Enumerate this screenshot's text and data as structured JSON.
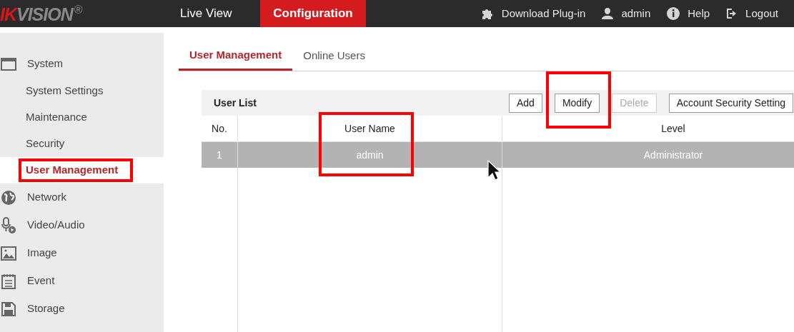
{
  "logo": {
    "accent": "IK",
    "text": "VISION",
    "mark": "®"
  },
  "nav": [
    {
      "label": "Live View",
      "selected": false
    },
    {
      "label": "Configuration",
      "selected": true
    }
  ],
  "header_actions": [
    {
      "kind": "plugin",
      "label": "Download Plug-in"
    },
    {
      "kind": "user",
      "label": "admin"
    },
    {
      "kind": "help",
      "label": "Help"
    },
    {
      "kind": "logout",
      "label": "Logout"
    }
  ],
  "sidebar": {
    "items": [
      {
        "kind": "system",
        "label": "System",
        "children": [
          {
            "label": "System Settings",
            "selected": false
          },
          {
            "label": "Maintenance",
            "selected": false
          },
          {
            "label": "Security",
            "selected": false
          },
          {
            "label": "User Management",
            "selected": true,
            "highlighted": true
          }
        ]
      },
      {
        "kind": "network",
        "label": "Network"
      },
      {
        "kind": "video",
        "label": "Video/Audio"
      },
      {
        "kind": "image",
        "label": "Image"
      },
      {
        "kind": "event",
        "label": "Event"
      },
      {
        "kind": "storage",
        "label": "Storage"
      }
    ]
  },
  "tabs": [
    {
      "label": "User Management",
      "selected": true
    },
    {
      "label": "Online Users",
      "selected": false
    }
  ],
  "user_list": {
    "title": "User List",
    "buttons": [
      {
        "label": "Add",
        "disabled": false
      },
      {
        "label": "Modify",
        "disabled": false,
        "highlighted": true
      },
      {
        "label": "Delete",
        "disabled": true
      },
      {
        "label": "Account Security Setting",
        "disabled": false
      }
    ],
    "columns": [
      {
        "label": "No."
      },
      {
        "label": "User Name",
        "highlighted": true
      },
      {
        "label": "Level"
      }
    ],
    "rows": [
      {
        "cells": [
          "1",
          "admin",
          "Administrator"
        ],
        "selected": true
      }
    ]
  }
}
